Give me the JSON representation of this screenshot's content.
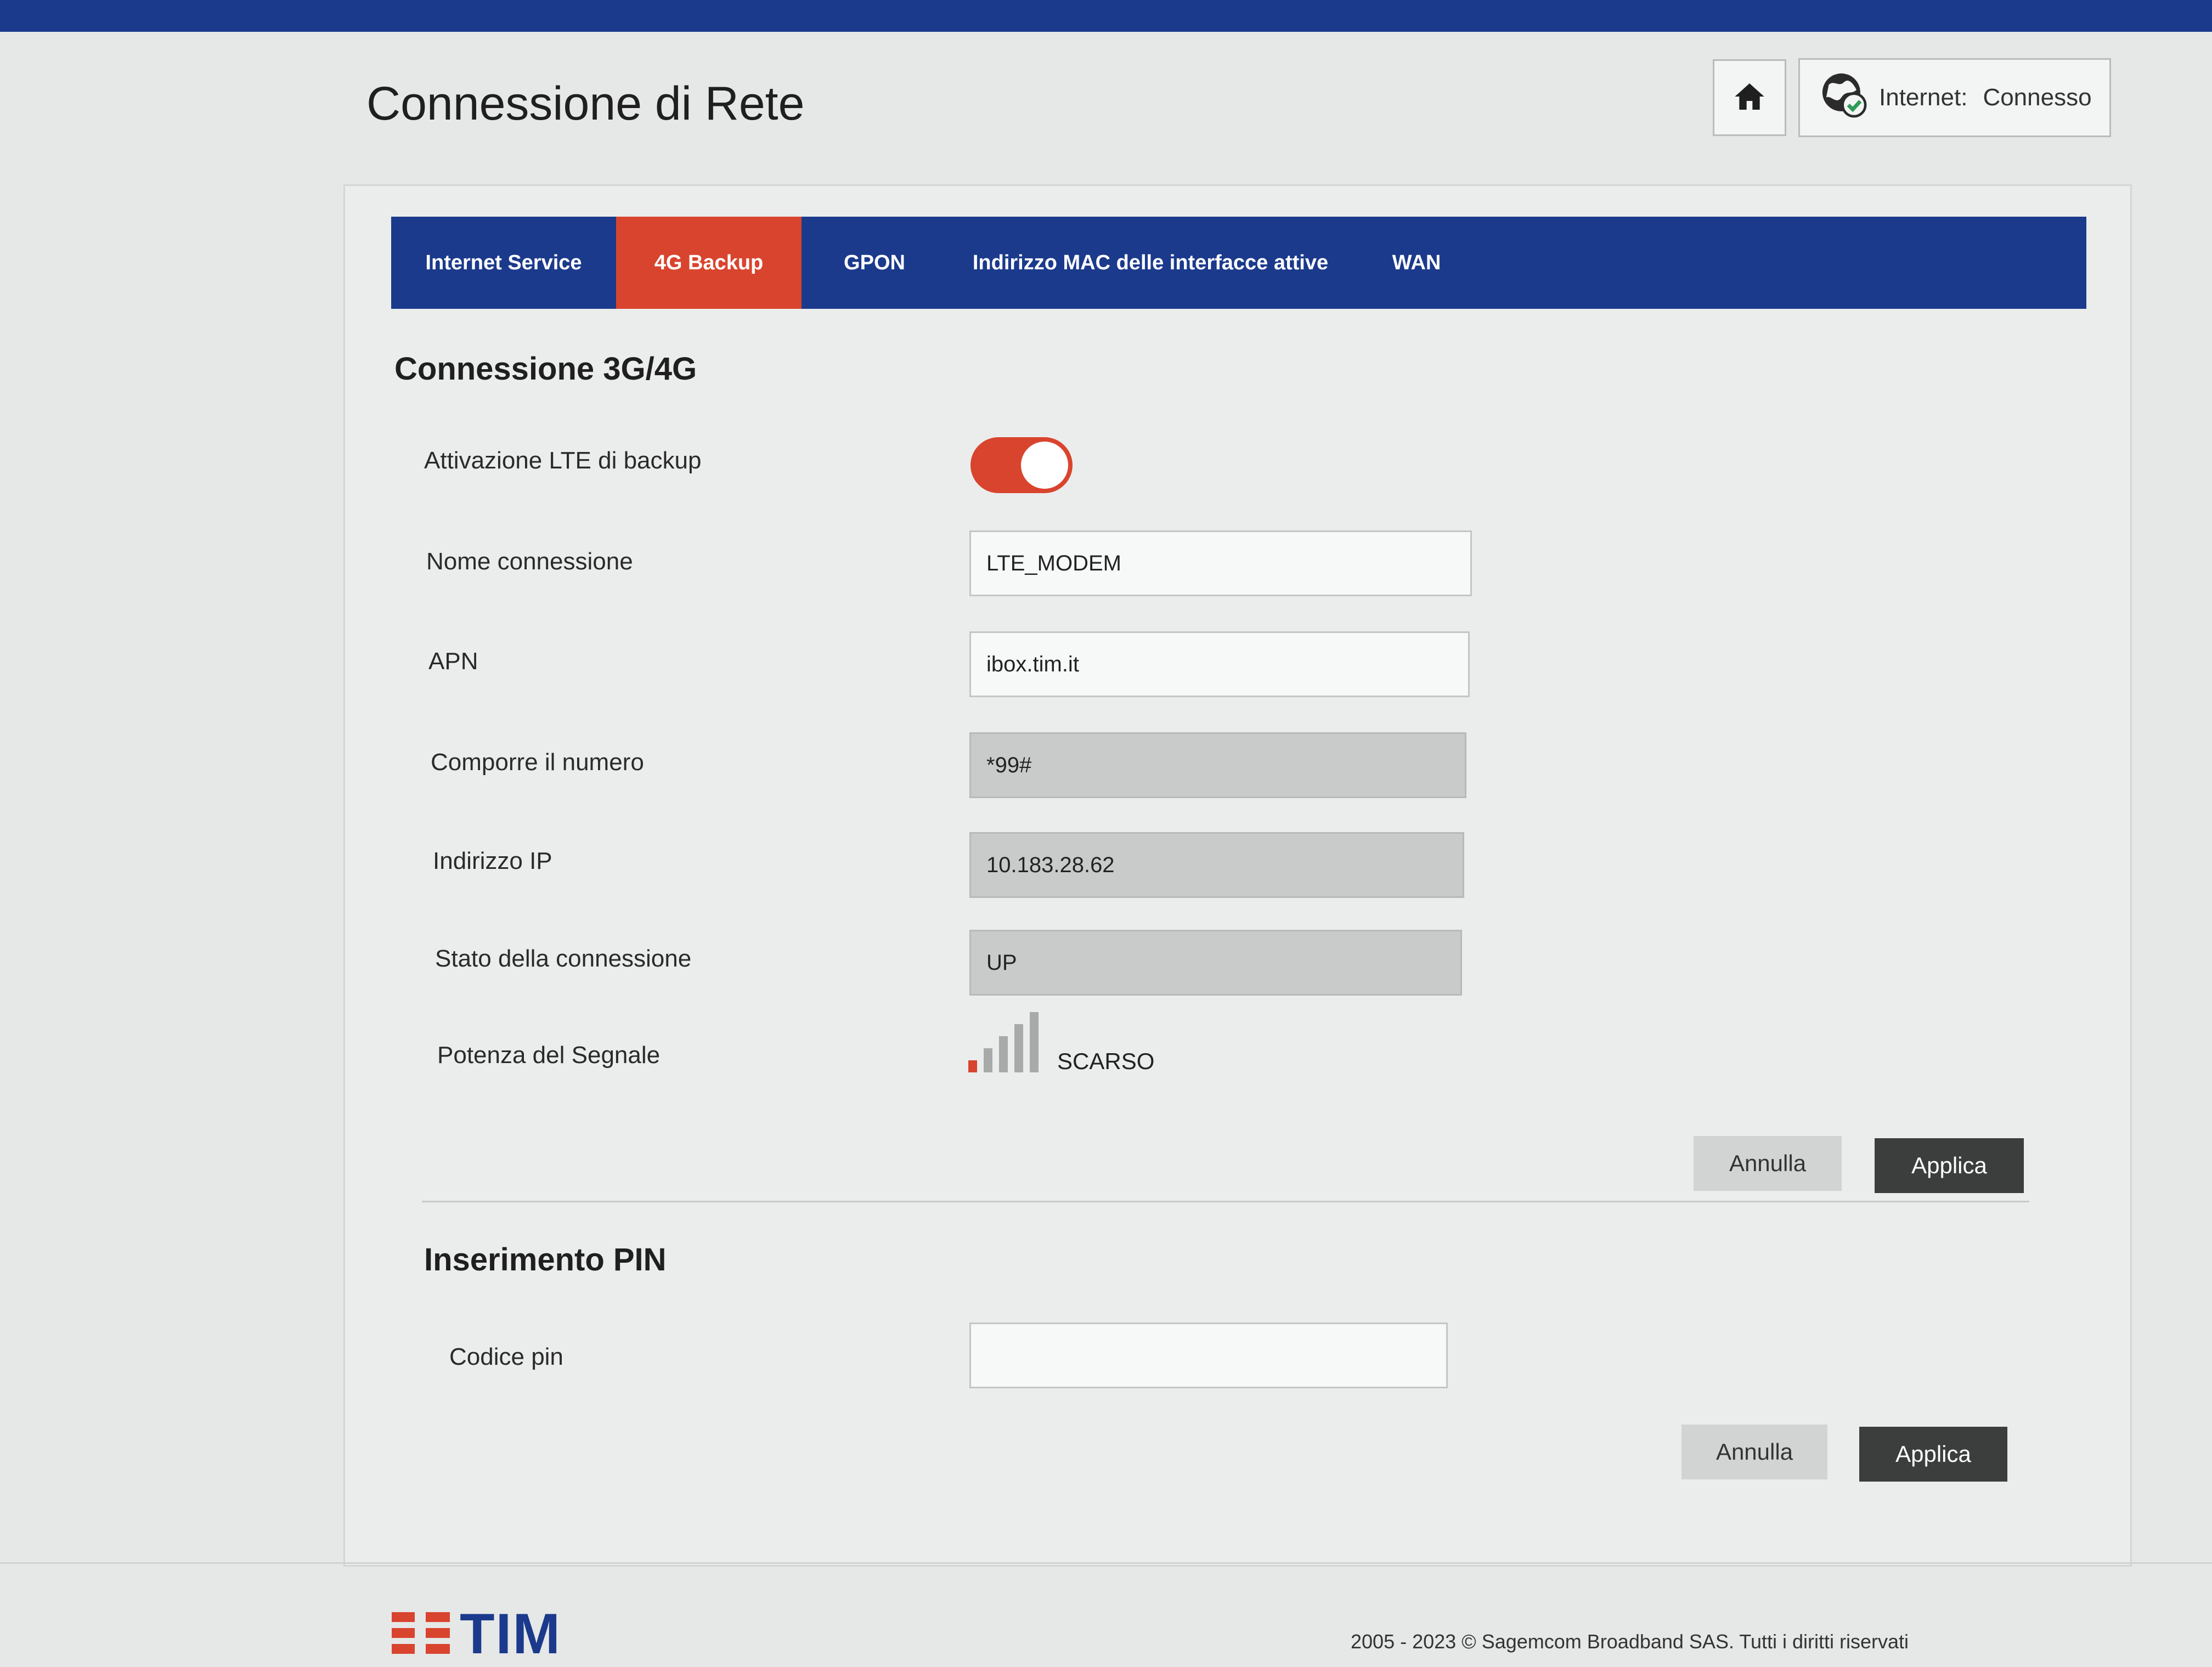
{
  "header": {
    "title": "Connessione di Rete",
    "internet_label": "Internet:",
    "internet_status": "Connesso"
  },
  "tabs": [
    {
      "label": "Internet Service",
      "active": false
    },
    {
      "label": "4G Backup",
      "active": true
    },
    {
      "label": "GPON",
      "active": false
    },
    {
      "label": "Indirizzo MAC delle interfacce attive",
      "active": false
    },
    {
      "label": "WAN",
      "active": false
    }
  ],
  "connection": {
    "title": "Connessione 3G/4G",
    "lte_backup_label": "Attivazione LTE di backup",
    "lte_backup_on": true,
    "name_label": "Nome connessione",
    "name_value": "LTE_MODEM",
    "apn_label": "APN",
    "apn_value": "ibox.tim.it",
    "dial_label": "Comporre il numero",
    "dial_value": "*99#",
    "ip_label": "Indirizzo IP",
    "ip_value": "10.183.28.62",
    "status_label": "Stato della connessione",
    "status_value": "UP",
    "signal_label": "Potenza del Segnale",
    "signal_text": "SCARSO",
    "signal_level": 1,
    "signal_max": 5,
    "cancel_label": "Annulla",
    "apply_label": "Applica"
  },
  "pin": {
    "title": "Inserimento PIN",
    "code_label": "Codice pin",
    "code_value": "",
    "cancel_label": "Annulla",
    "apply_label": "Applica"
  },
  "footer": {
    "logo_text": "TIM",
    "copyright": "2005 - 2023 © Sagemcom Broadband SAS. Tutti i diritti riservati"
  },
  "colors": {
    "brand_blue": "#1b3a8c",
    "accent_red": "#d9442e"
  },
  "icons": {
    "home": "home-icon",
    "internet": "globe-check-icon",
    "logo": "tim-logo-icon"
  }
}
